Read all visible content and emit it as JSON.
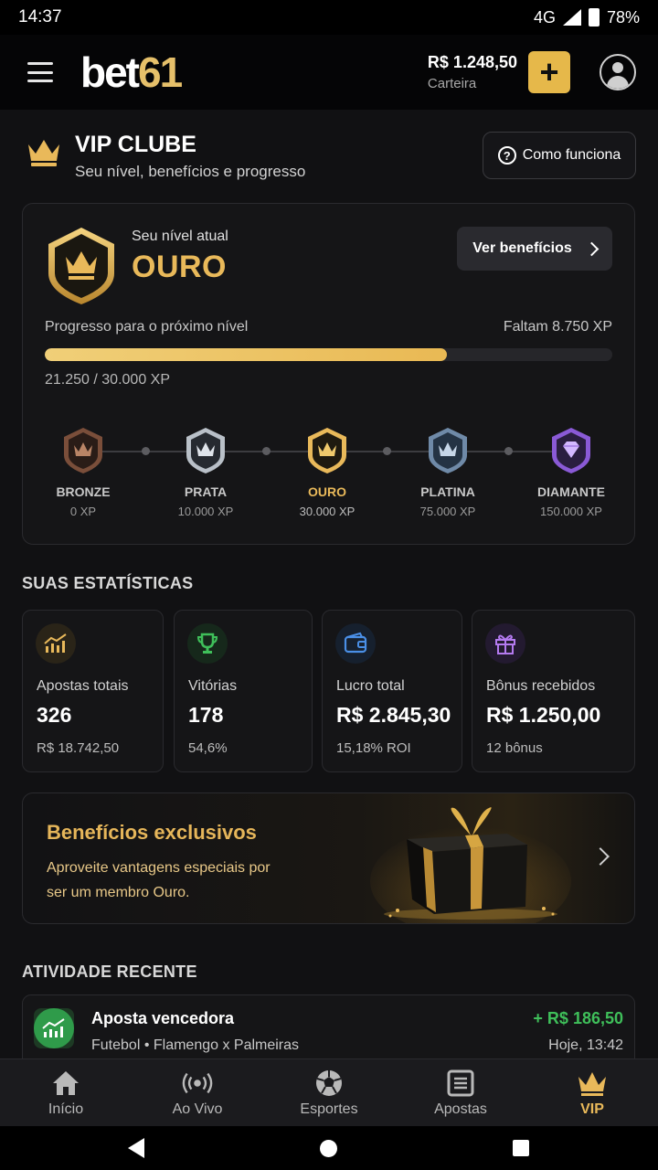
{
  "status_bar": {
    "time": "14:37",
    "network": "4G",
    "battery": "78%"
  },
  "header": {
    "logo_text": "bet",
    "logo_number": "61",
    "wallet_amount": "R$ 1.248,50",
    "wallet_label": "Carteira",
    "add_label": "+"
  },
  "vip": {
    "title": "VIP CLUBE",
    "subtitle": "Seu nível, benefícios e progresso",
    "how_label": "Como funciona"
  },
  "level": {
    "current_label": "Seu nível atual",
    "current_name": "OURO",
    "benefits_button": "Ver benefícios",
    "progress_label": "Progresso para o próximo nível",
    "remaining": "Faltam 8.750 XP",
    "progress_fraction": 0.7083,
    "progress_text": "21.250 / 30.000 XP",
    "tiers": [
      {
        "name": "BRONZE",
        "xp": "0 XP"
      },
      {
        "name": "PRATA",
        "xp": "10.000 XP"
      },
      {
        "name": "OURO",
        "xp": "30.000 XP"
      },
      {
        "name": "PLATINA",
        "xp": "75.000 XP"
      },
      {
        "name": "DIAMANTE",
        "xp": "150.000 XP"
      }
    ]
  },
  "stats": {
    "title": "SUAS ESTATÍSTICAS",
    "items": [
      {
        "label": "Apostas totais",
        "value": "326",
        "sub": "R$ 18.742,50",
        "icon": "chart-up-icon"
      },
      {
        "label": "Vitórias",
        "value": "178",
        "sub": "54,6%",
        "icon": "trophy-icon"
      },
      {
        "label": "Lucro total",
        "value": "R$ 2.845,30",
        "sub": "15,18% ROI",
        "icon": "wallet-icon"
      },
      {
        "label": "Bônus recebidos",
        "value": "R$ 1.250,00",
        "sub": "12 bônus",
        "icon": "gift-icon"
      }
    ]
  },
  "promo": {
    "title": "Benefícios exclusivos",
    "text": "Aproveite vantagens especiais por ser um membro Ouro."
  },
  "activity": {
    "title": "ATIVIDADE RECENTE",
    "items": [
      {
        "title": "Aposta vencedora",
        "sub": "Futebol • Flamengo x Palmeiras",
        "amount": "+ R$ 186,50",
        "time": "Hoje, 13:42"
      }
    ]
  },
  "nav": {
    "items": [
      {
        "label": "Início",
        "icon": "home-icon"
      },
      {
        "label": "Ao Vivo",
        "icon": "live-icon"
      },
      {
        "label": "Esportes",
        "icon": "soccer-ball-icon"
      },
      {
        "label": "Apostas",
        "icon": "betslip-icon"
      },
      {
        "label": "VIP",
        "icon": "crown-icon"
      }
    ],
    "active": "VIP"
  },
  "colors": {
    "accent": "#e9b95a",
    "positive": "#3fbf5a",
    "background": "#111113"
  }
}
